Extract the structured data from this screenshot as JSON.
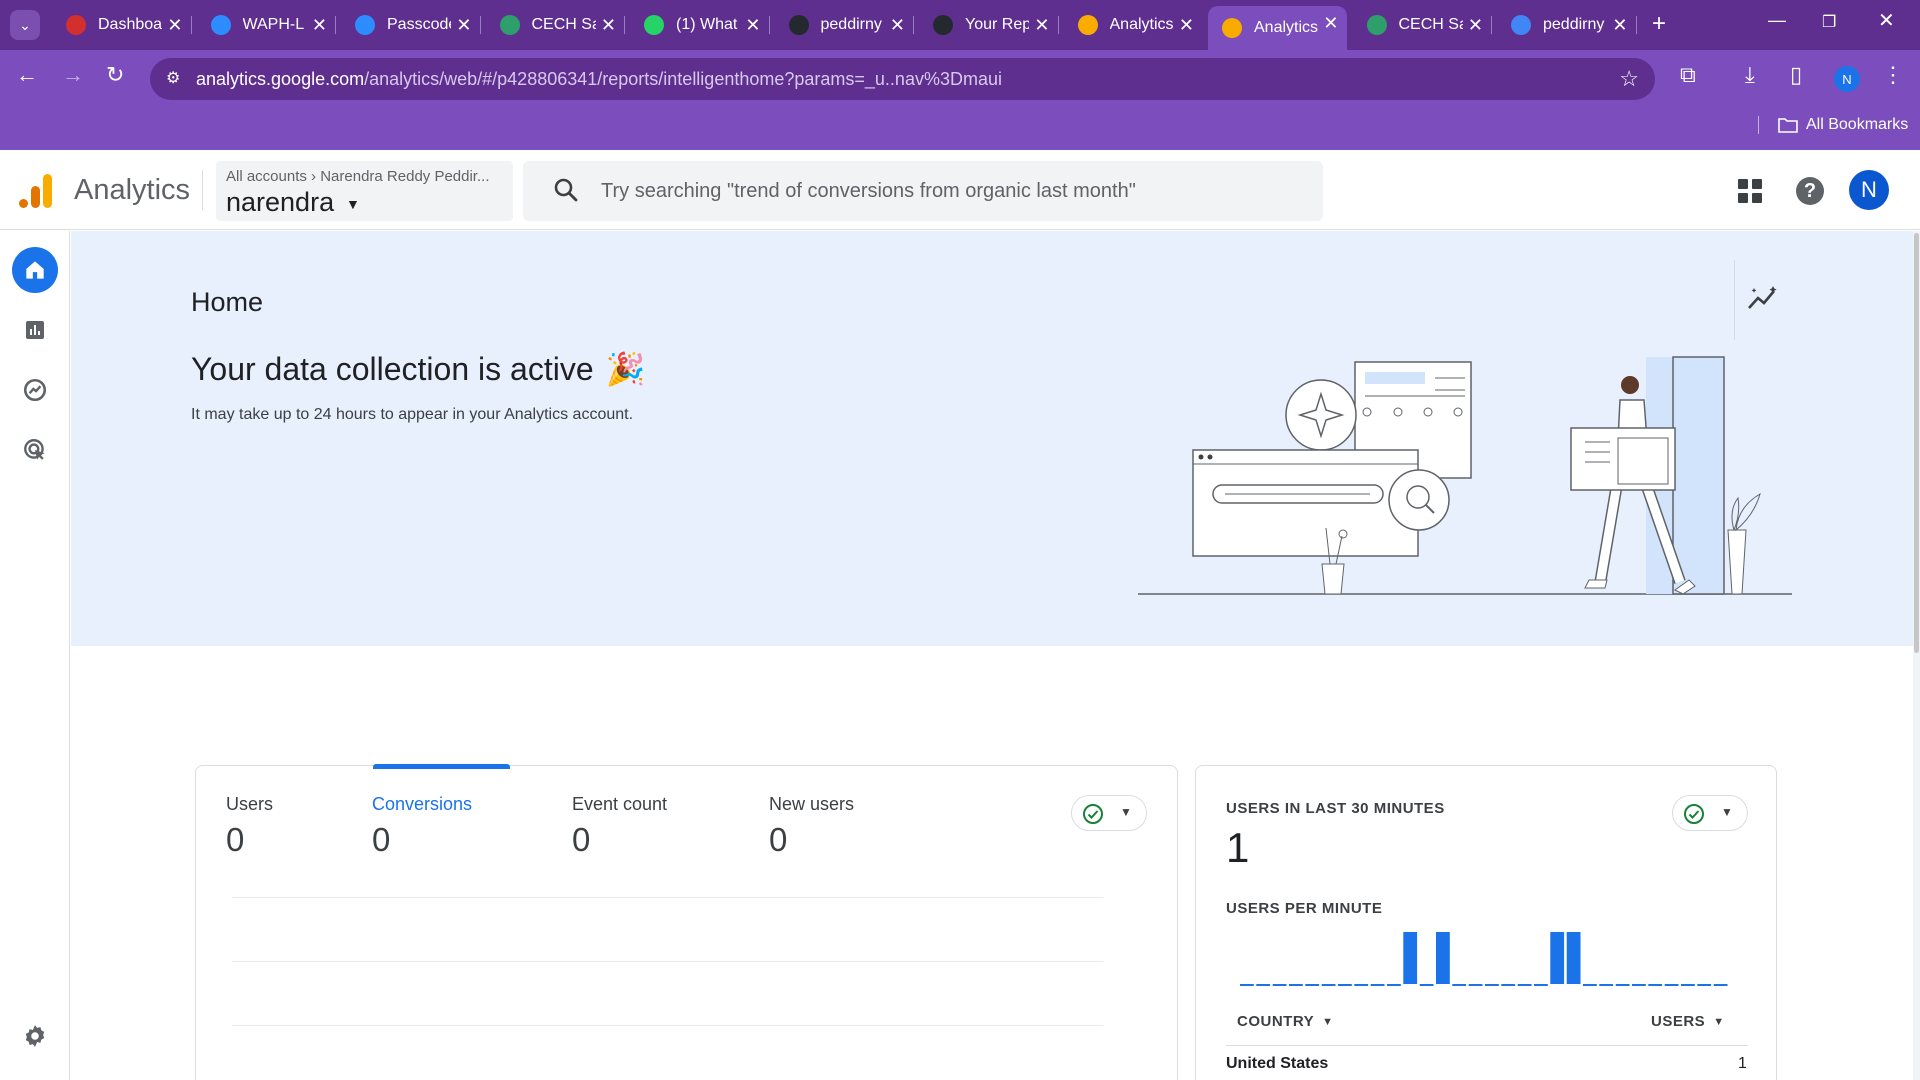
{
  "browser": {
    "tabs": [
      {
        "title": "Dashboard",
        "favicon": "canvas-icon",
        "color": "#d32f2f"
      },
      {
        "title": "WAPH-L",
        "favicon": "zoom-icon",
        "color": "#2d8cff"
      },
      {
        "title": "Passcode",
        "favicon": "zoom-icon",
        "color": "#2d8cff"
      },
      {
        "title": "CECH Sa",
        "favicon": "globe-icon",
        "color": "#2e9e6b"
      },
      {
        "title": "(1) What",
        "favicon": "whatsapp-icon",
        "color": "#25d366"
      },
      {
        "title": "peddirny",
        "favicon": "github-icon",
        "color": "#24292f"
      },
      {
        "title": "Your Rep",
        "favicon": "github-icon",
        "color": "#24292f"
      },
      {
        "title": "Analytics",
        "favicon": "analytics-icon",
        "color": "#f9ab00"
      },
      {
        "title": "Analytics",
        "favicon": "analytics-icon",
        "color": "#f9ab00"
      },
      {
        "title": "CECH Sa",
        "favicon": "globe-icon",
        "color": "#2e9e6b"
      },
      {
        "title": "peddirny",
        "favicon": "monitor-icon",
        "color": "#4285f4"
      }
    ],
    "active_tab_index": 8,
    "url_host": "analytics.google.com",
    "url_path": "/analytics/web/#/p428806341/reports/intelligenthome?params=_u..nav%3Dmaui",
    "profile_initial": "N",
    "bookmarks_label": "All Bookmarks"
  },
  "ga": {
    "product_name": "Analytics",
    "account_crumb_root": "All accounts",
    "account_crumb_child": "Narendra Reddy Peddir...",
    "property_name": "narendra",
    "search_placeholder": "Try searching \"trend of conversions from organic last month\"",
    "avatar_initial": "N"
  },
  "hero": {
    "title": "Home",
    "headline": "Your data collection is active",
    "headline_emoji": "🎉",
    "description": "It may take up to 24 hours to appear in your Analytics account."
  },
  "metrics": [
    {
      "label": "Users",
      "value": "0"
    },
    {
      "label": "Conversions",
      "value": "0"
    },
    {
      "label": "Event count",
      "value": "0"
    },
    {
      "label": "New users",
      "value": "0"
    }
  ],
  "selected_metric_index": 1,
  "realtime": {
    "title": "USERS IN LAST 30 MINUTES",
    "value": "1",
    "per_minute_label": "USERS PER MINUTE",
    "country_header": "COUNTRY",
    "users_header": "USERS",
    "rows": [
      {
        "country": "United States",
        "users": "1"
      }
    ]
  },
  "chart_data": {
    "type": "bar",
    "series": [
      {
        "values": [
          0,
          0,
          0,
          0,
          0,
          0,
          0,
          0,
          0,
          0,
          1,
          0,
          1,
          0,
          0,
          0,
          0,
          0,
          0,
          1,
          1,
          0,
          0,
          0,
          0,
          0,
          0,
          0,
          0,
          0
        ]
      }
    ],
    "ylim": [
      0,
      1
    ]
  },
  "colors": {
    "accent": "#1a73e8",
    "hero_bg": "#e8f0fe",
    "browser_frame": "#7b4dbd",
    "success": "#188038"
  }
}
